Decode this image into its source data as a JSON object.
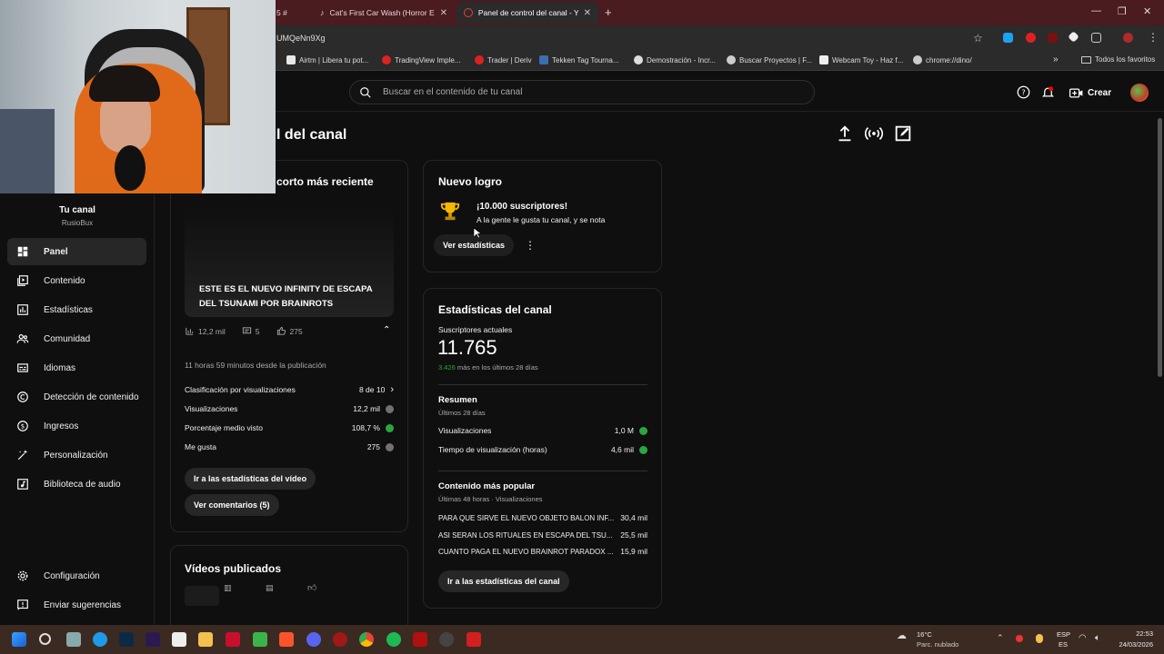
{
  "browser": {
    "tabs": [
      {
        "label": "5 #",
        "active": false
      },
      {
        "label": "Cat's First Car Wash (Horror Ed",
        "active": false
      },
      {
        "label": "Panel de control del canal - You",
        "active": true
      }
    ],
    "new_tab": "+",
    "url": "UMQeNn9Xg",
    "bookmarks": [
      "Airtm | Libera tu pot...",
      "TradingView Imple...",
      "Trader | Deriv",
      "Tekken Tag Tourna...",
      "Demostración - Incr...",
      "Buscar Proyectos | F...",
      "Webcam Toy - Haz f...",
      "chrome://dino/"
    ],
    "all_bookmarks": "Todos los favoritos"
  },
  "header": {
    "search_placeholder": "Buscar en el contenido de tu canal",
    "create_label": "Crear"
  },
  "sidebar": {
    "channel_name": "Tu canal",
    "channel_handle": "RusioBux",
    "items": [
      {
        "label": "Panel",
        "icon": "dashboard-icon",
        "active": true
      },
      {
        "label": "Contenido",
        "icon": "content-icon"
      },
      {
        "label": "Estadísticas",
        "icon": "analytics-icon"
      },
      {
        "label": "Comunidad",
        "icon": "community-icon"
      },
      {
        "label": "Idiomas",
        "icon": "subtitles-icon"
      },
      {
        "label": "Detección de contenido",
        "icon": "copyright-icon"
      },
      {
        "label": "Ingresos",
        "icon": "dollar-icon"
      },
      {
        "label": "Personalización",
        "icon": "magic-wand-icon"
      },
      {
        "label": "Biblioteca de audio",
        "icon": "audio-library-icon"
      }
    ],
    "bottom": [
      {
        "label": "Configuración",
        "icon": "gear-icon"
      },
      {
        "label": "Enviar sugerencias",
        "icon": "feedback-icon"
      }
    ]
  },
  "main": {
    "page_title": "l del canal",
    "short_card": {
      "title": "corto más reciente",
      "video_title": "ESTE ES EL NUEVO INFINITY DE ESCAPA DEL TSUNAMI POR BRAINROTS",
      "views": "12,2 mil",
      "comments": "5",
      "likes": "275",
      "published": "11 horas 59 minutos desde la publicación",
      "stats": [
        {
          "label": "Clasificación por visualizaciones",
          "value": "8 de 10"
        },
        {
          "label": "Visualizaciones",
          "value": "12,2 mil",
          "status": "gray"
        },
        {
          "label": "Porcentaje medio visto",
          "value": "108,7 %",
          "status": "green"
        },
        {
          "label": "Me gusta",
          "value": "275",
          "status": "gray"
        }
      ],
      "btn_stats": "Ir a las estadísticas del vídeo",
      "btn_comments": "Ver comentarios (5)"
    },
    "published_card": {
      "title": "Vídeos publicados"
    },
    "achievement_card": {
      "title": "Nuevo logro",
      "headline": "¡10.000 suscriptores!",
      "subtitle": "A la gente le gusta tu canal, y se nota",
      "btn": "Ver estadísticas"
    },
    "channel_stats": {
      "title": "Estadísticas del canal",
      "subs_label": "Suscriptores actuales",
      "subs_value": "11.765",
      "subs_delta": "3.426",
      "subs_delta_text": " más en los últimos 28 días",
      "summary_title": "Resumen",
      "summary_period": "Últimos 28 días",
      "summary_rows": [
        {
          "label": "Visualizaciones",
          "value": "1,0 M"
        },
        {
          "label": "Tiempo de visualización (horas)",
          "value": "4,6 mil"
        }
      ],
      "popular_title": "Contenido más popular",
      "popular_period": "Últimas 48 horas · Visualizaciones",
      "popular_rows": [
        {
          "label": "PARA QUE SIRVE EL NUEVO OBJETO BALON INF...",
          "value": "30,4 mil"
        },
        {
          "label": "ASI SERAN LOS RITUALES EN ESCAPA DEL TSU...",
          "value": "25,5 mil"
        },
        {
          "label": "CUANTO PAGA EL NUEVO BRAINROT PARADOX ...",
          "value": "15,9 mil"
        }
      ],
      "btn": "Ir a las estadísticas del canal"
    }
  },
  "taskbar": {
    "weather_temp": "16°C",
    "weather_desc": "Parc. nublado",
    "lang1": "ESP",
    "lang2": "ES",
    "time": "22:53",
    "date": "24/03/2026"
  },
  "colors": {
    "accent_red": "#ff0000",
    "green": "#2ba640",
    "chrome_tab": "#4a1b1f"
  }
}
